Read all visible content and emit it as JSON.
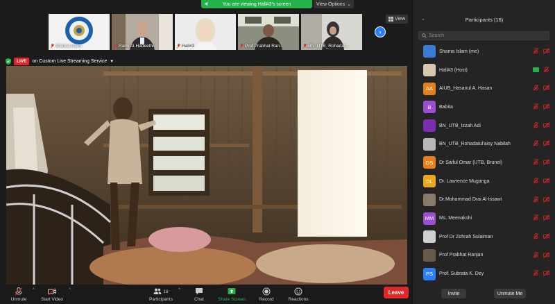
{
  "banner": {
    "text": "You are viewing Hall#3's screen",
    "view_options": "View Options"
  },
  "thumbnails": [
    {
      "name": "Shama Islam"
    },
    {
      "name": "Rami Al-Hadeethi"
    },
    {
      "name": "Hall#3"
    },
    {
      "name": "Prof Prabhat Ran..."
    },
    {
      "name": "BN_UTB_Rohadat..."
    }
  ],
  "view_button": "View",
  "live": {
    "badge": "LIVE",
    "service": "on Custom Live Streaming Service"
  },
  "toolbar": {
    "unmute": "Unmute",
    "start_video": "Start Video",
    "participants": "Participants",
    "participants_count": "18",
    "chat": "Chat",
    "share_screen": "Share Screen",
    "record": "Record",
    "reactions": "Reactions",
    "leave": "Leave"
  },
  "panel": {
    "title": "Participants (18)",
    "search_placeholder": "Search",
    "invite": "Invite",
    "unmute_me": "Unmute Me",
    "participants": [
      {
        "name": "Shama Islam (me)",
        "initials": "",
        "color": "#3a7bd5"
      },
      {
        "name": "Hall#3 (Host)",
        "initials": "",
        "color": "#d8c8b0"
      },
      {
        "name": "AIUB_Hasanul A. Hasan",
        "initials": "AA",
        "color": "#e8801a"
      },
      {
        "name": "Babita",
        "initials": "B",
        "color": "#9b4fd0"
      },
      {
        "name": "BN_UTB_Izzah Adi",
        "initials": "",
        "color": "#7a2fb0"
      },
      {
        "name": "BN_UTB_Rohadatul'aisy Nabilah",
        "initials": "",
        "color": "#b8b8b8"
      },
      {
        "name": "Dr Saiful Omar (UTB, Brunei)",
        "initials": "DS",
        "color": "#e8801a"
      },
      {
        "name": "Dr. Lawrence Muganga",
        "initials": "DL",
        "color": "#e8a81a"
      },
      {
        "name": "Dr.Mohammad Drai Al-Issawi",
        "initials": "",
        "color": "#8a7a6a"
      },
      {
        "name": "Ms. Meenakshi",
        "initials": "MM",
        "color": "#9b4fd0"
      },
      {
        "name": "Prof Dr Zohrah Sulaiman",
        "initials": "",
        "color": "#d0d0d0"
      },
      {
        "name": "Prof Prabhat Ranjan",
        "initials": "",
        "color": "#6a5a4a"
      },
      {
        "name": "Prof. Subrata K. Dey",
        "initials": "PS",
        "color": "#2d7ff9"
      }
    ]
  }
}
